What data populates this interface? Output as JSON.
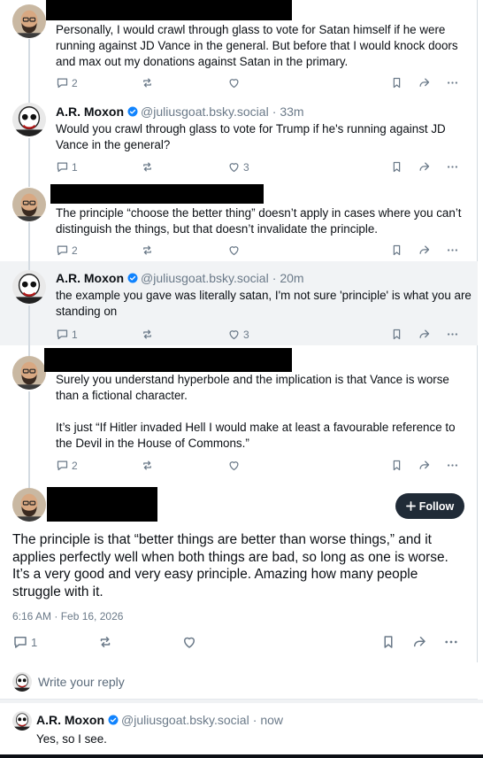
{
  "posts": [
    {
      "text": "Personally, I would crawl through glass to vote for Satan himself if he were running against JD Vance in the general. But before that I would knock doors and max out my donations against Satan in the primary.",
      "replies": "2",
      "likes": ""
    },
    {
      "name": "A.R. Moxon",
      "handle": "@juliusgoat.bsky.social",
      "time": "33m",
      "text": "Would you crawl through glass to vote for Trump if he's running against JD Vance in the general?",
      "replies": "1",
      "likes": "3"
    },
    {
      "text": "The principle “choose the better thing” doesn’t apply in cases where you can’t distinguish the things, but that doesn’t invalidate the principle.",
      "replies": "2",
      "likes": ""
    },
    {
      "name": "A.R. Moxon",
      "handle": "@juliusgoat.bsky.social",
      "time": "20m",
      "text": "the example you gave was literally satan, I'm not sure 'principle' is what you are standing on",
      "replies": "1",
      "likes": "3"
    },
    {
      "text_1": "Surely you understand hyperbole and the implication is that Vance is worse than a fictional character.",
      "text_2": "It’s just “If Hitler invaded Hell I would make at least a favourable reference to the Devil in the House of Commons.”",
      "replies": "2",
      "likes": ""
    }
  ],
  "main_post": {
    "follow_label": "Follow",
    "text": "The principle is that “better things are better than worse things,” and it applies perfectly well when both things are bad, so long as one is worse. It’s a very good and very easy principle. Amazing how many people struggle with it.",
    "date": "6:16 AM · Feb 16, 2026",
    "replies": "1"
  },
  "reply_box": {
    "placeholder": "Write your reply"
  },
  "reply_post": {
    "name": "A.R. Moxon",
    "handle": "@juliusgoat.bsky.social",
    "time": "now",
    "text": "Yes, so I see."
  },
  "separator": "·",
  "colors": {
    "accent": "#1083fe",
    "text": "#0b0f14",
    "muted": "#6b7a89",
    "highlight": "#f1f3f5",
    "button": "#202b37"
  },
  "icons": [
    "reply-icon",
    "repost-icon",
    "like-icon",
    "bookmark-icon",
    "share-icon",
    "more-icon",
    "verified-check-icon",
    "plus-icon"
  ]
}
